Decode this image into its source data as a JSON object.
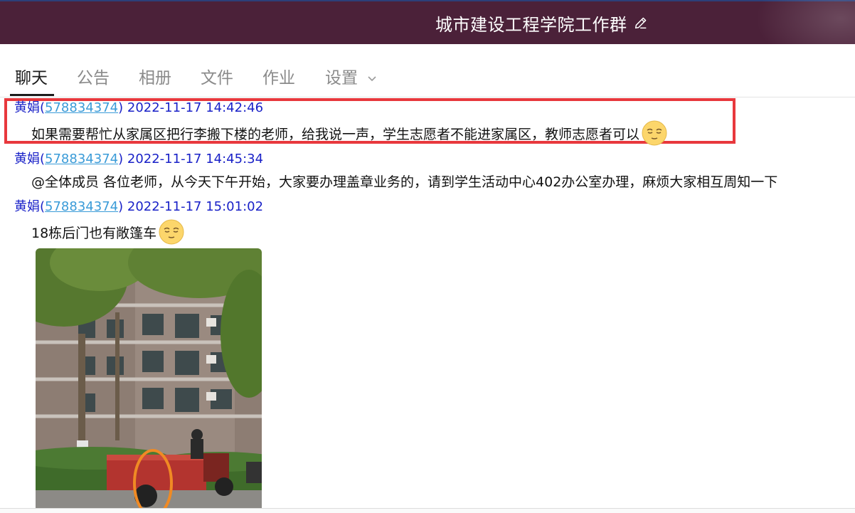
{
  "window": {
    "title": "城市建设工程学院工作群",
    "edit_icon": "pencil-icon"
  },
  "tabs": [
    {
      "label": "聊天",
      "active": true
    },
    {
      "label": "公告",
      "active": false
    },
    {
      "label": "相册",
      "active": false
    },
    {
      "label": "文件",
      "active": false
    },
    {
      "label": "作业",
      "active": false
    },
    {
      "label": "设置",
      "active": false,
      "has_dropdown": true
    }
  ],
  "messages": [
    {
      "sender": "黄娟",
      "qq_open": "(",
      "qq": "578834374",
      "qq_close": ")",
      "time": "2022-11-17 14:42:46",
      "text": "如果需要帮忙从家属区把行李搬下楼的老师，给我说一声，学生志愿者不能进家属区，教师志愿者可以",
      "emoji": "smug-face-emoji",
      "highlighted": true
    },
    {
      "sender": "黄娟",
      "qq_open": "(",
      "qq": "578834374",
      "qq_close": ")",
      "time": "2022-11-17 14:45:34",
      "text": "@全体成员 各位老师，从今天下午开始，大家要办理盖章业务的，请到学生活动中心402办公室办理，麻烦大家相互周知一下"
    },
    {
      "sender": "黄娟",
      "qq_open": "(",
      "qq": "578834374",
      "qq_close": ")",
      "time": "2022-11-17 15:01:02",
      "text": "18栋后门也有敞篷车",
      "emoji": "smug-face-emoji",
      "image": "photo of apartment building with red tricycle cart"
    }
  ],
  "colors": {
    "titlebar": "#4b2139",
    "sender": "#1a22c8",
    "qq_link": "#3a9bd8",
    "highlight": "#e8383d"
  }
}
